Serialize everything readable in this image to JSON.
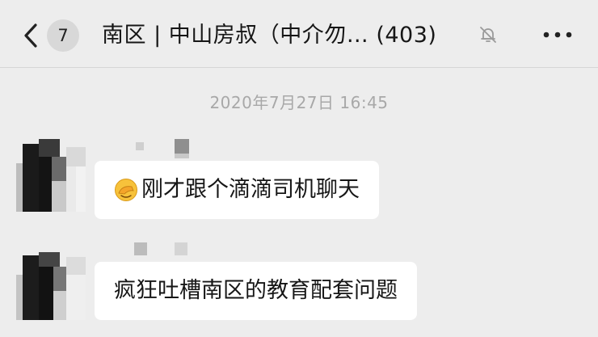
{
  "header": {
    "back_label": "<",
    "unread_count": "7",
    "title": "南区 | 中山房叔（中介勿…  (403)",
    "more_label": "···"
  },
  "timestamp": "2020年7月27日 16:45",
  "messages": [
    {
      "emoji": "facepalm-emoji",
      "text": "刚才跟个滴滴司机聊天"
    },
    {
      "text": "疯狂吐槽南区的教育配套问题"
    }
  ],
  "colors": {
    "background": "#ededed",
    "bubble": "#ffffff",
    "timestamp": "#a8a8a8",
    "badge": "#d8d8d8"
  },
  "icons": [
    "chevron-left-icon",
    "bell-muted-icon",
    "more-dots-icon"
  ]
}
